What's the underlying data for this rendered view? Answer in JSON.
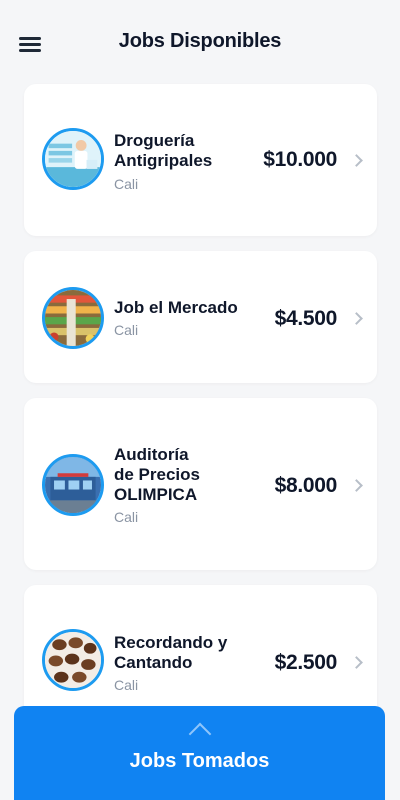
{
  "header": {
    "title": "Jobs Disponibles"
  },
  "jobs": [
    {
      "name": "Droguería\nAntigripales",
      "city": "Cali",
      "price": "$10.000",
      "image": "pharmacy-image"
    },
    {
      "name": "Job el Mercado",
      "city": "Cali",
      "price": "$4.500",
      "image": "market-image"
    },
    {
      "name": "Auditoría\nde Precios\nOLIMPICA",
      "city": "Cali",
      "price": "$8.000",
      "image": "store-image"
    },
    {
      "name": "Recordando y\nCantando",
      "city": "Cali",
      "price": "$2.500",
      "image": "coffee-beans-image"
    }
  ],
  "bottom_sheet": {
    "label": "Jobs Tomados"
  },
  "colors": {
    "accent": "#1083f2",
    "avatar_ring": "#1d9bf0",
    "background": "#f5f6f8"
  }
}
